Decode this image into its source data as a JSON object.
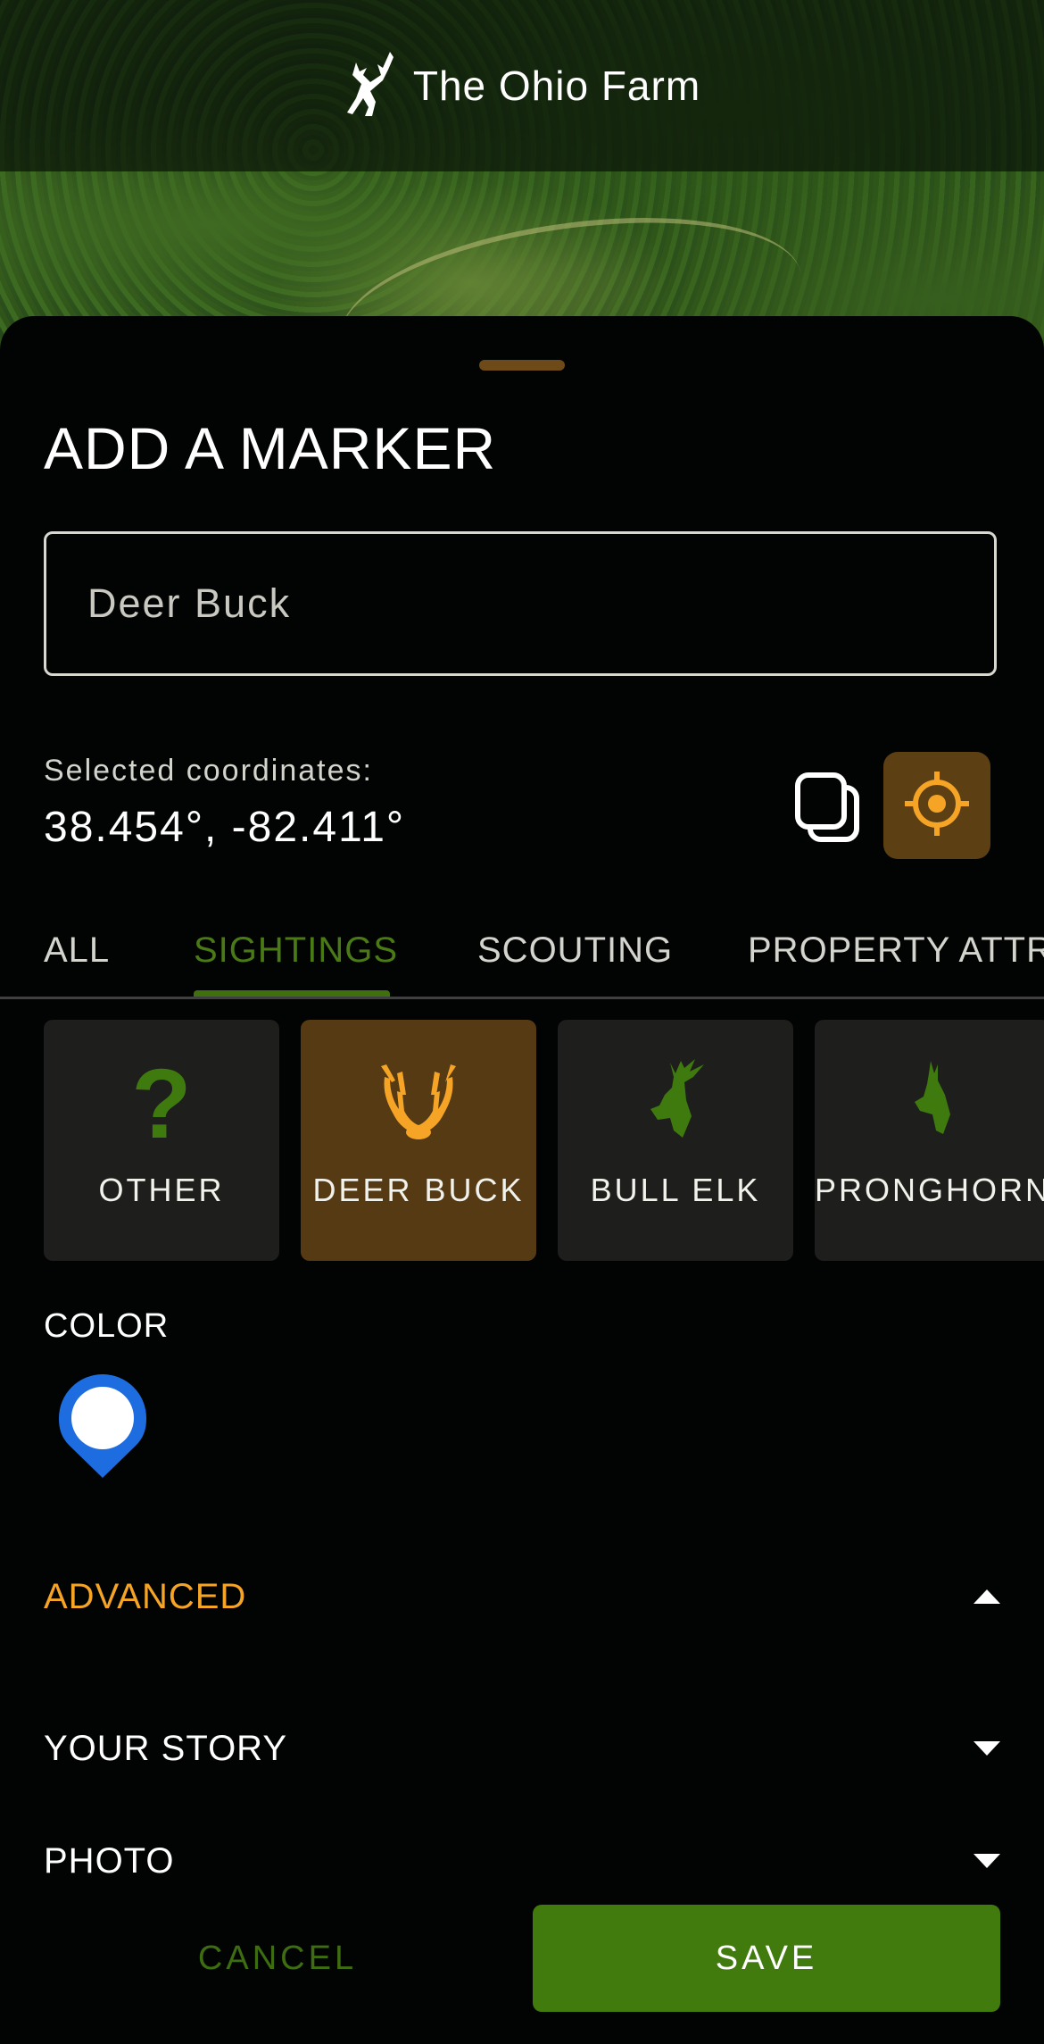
{
  "header": {
    "title": "The Ohio Farm",
    "logo_icon": "deer-logo-icon"
  },
  "sheet": {
    "title": "ADD A MARKER",
    "name_field": {
      "value": "Deer Buck"
    },
    "coordinates": {
      "label": "Selected coordinates:",
      "value": "38.454°, -82.411°",
      "copy_icon": "copy-icon",
      "locate_icon": "crosshair-icon"
    },
    "tabs": [
      {
        "label": "ALL",
        "active": false
      },
      {
        "label": "SIGHTINGS",
        "active": true
      },
      {
        "label": "SCOUTING",
        "active": false
      },
      {
        "label": "PROPERTY ATTR",
        "active": false
      }
    ],
    "categories": [
      {
        "label": "OTHER",
        "icon": "question-mark-icon",
        "selected": false
      },
      {
        "label": "DEER BUCK",
        "icon": "antlers-icon",
        "selected": true
      },
      {
        "label": "BULL ELK",
        "icon": "elk-head-icon",
        "selected": false
      },
      {
        "label": "PRONGHORN",
        "icon": "pronghorn-head-icon",
        "selected": false
      }
    ],
    "color": {
      "label": "COLOR",
      "selected": "#1e6de0"
    },
    "sections": {
      "advanced": "ADVANCED",
      "your_story": "YOUR STORY",
      "photo": "PHOTO"
    },
    "actions": {
      "cancel": "CANCEL",
      "save": "SAVE"
    }
  },
  "colors": {
    "accent_orange": "#f5a426",
    "accent_green": "#417a0d",
    "selected_card": "#553a13",
    "pin_blue": "#1e6de0"
  }
}
